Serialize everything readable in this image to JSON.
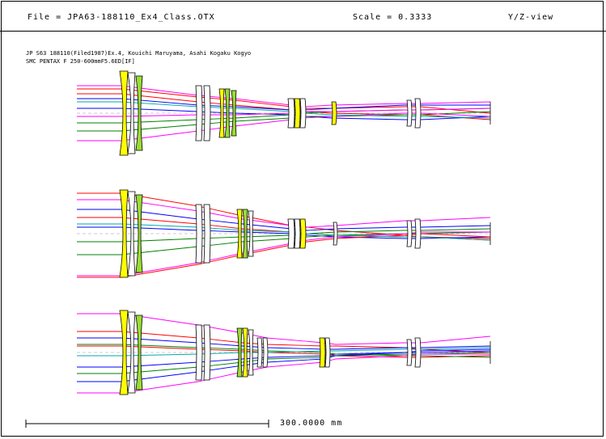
{
  "header": {
    "file_label": "File = JPA63-188110_Ex4_Class.OTX",
    "scale_label": "Scale = 0.3333",
    "view_label": "Y/Z-view"
  },
  "caption": {
    "line1": "JP S63 188110(Filed1987)Ex.4, Kouichi Maruyama, Asahi Kogaku Kogyo",
    "line2": "SMC PENTAX F 250-600mmF5.6ED[IF]"
  },
  "scale_bar": {
    "label": "300.0000 mm"
  },
  "ray_colors": [
    "#ff0000",
    "#0000ff",
    "#008000",
    "#ff00ff",
    "#00aaaa"
  ],
  "glass_colors": {
    "yellow": "#ffff00",
    "green": "#99dd33"
  },
  "configurations": [
    "zoom-position-1",
    "zoom-position-2",
    "zoom-position-3"
  ]
}
